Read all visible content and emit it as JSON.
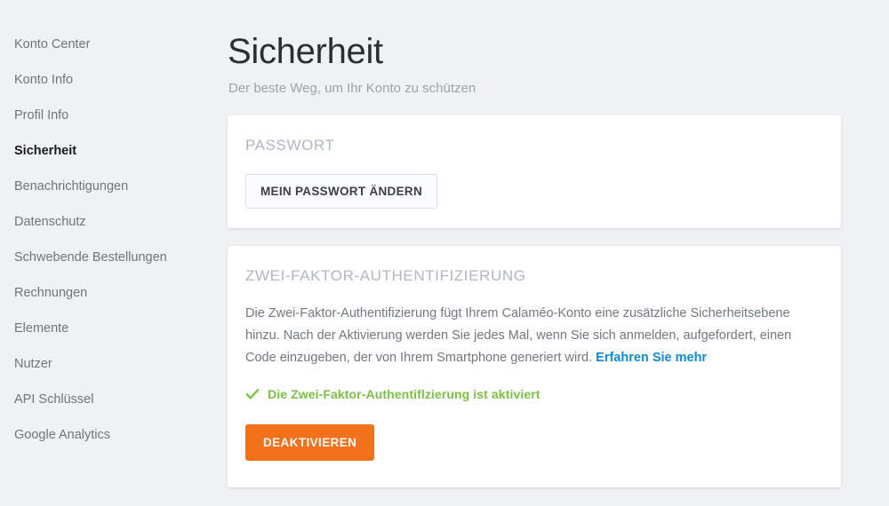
{
  "sidebar": {
    "items": [
      {
        "label": "Konto Center",
        "active": false
      },
      {
        "label": "Konto Info",
        "active": false
      },
      {
        "label": "Profil Info",
        "active": false
      },
      {
        "label": "Sicherheit",
        "active": true
      },
      {
        "label": "Benachrichtigungen",
        "active": false
      },
      {
        "label": "Datenschutz",
        "active": false
      },
      {
        "label": "Schwebende Bestellungen",
        "active": false
      },
      {
        "label": "Rechnungen",
        "active": false
      },
      {
        "label": "Elemente",
        "active": false
      },
      {
        "label": "Nutzer",
        "active": false
      },
      {
        "label": "API Schlüssel",
        "active": false
      },
      {
        "label": "Google Analytics",
        "active": false
      }
    ]
  },
  "header": {
    "title": "Sicherheit",
    "subtitle": "Der beste Weg, um Ihr Konto zu schützen"
  },
  "password_card": {
    "heading": "PASSWORT",
    "change_button_label": "MEIN PASSWORT ÄNDERN"
  },
  "twofa_card": {
    "heading": "ZWEI-FAKTOR-AUTHENTIFIZIERUNG",
    "description_part1": "Die Zwei-Faktor-Authentifizierung fügt Ihrem Calaméo-Konto eine zusätzliche Sicherheitsebene hinzu. Nach der Aktivierung werden Sie jedes Mal, wenn Sie sich anmelden, aufgefordert, einen Code einzugeben, der von Ihrem Smartphone generiert wird.",
    "learn_more_label": "Erfahren Sie mehr",
    "status_icon": "check-icon",
    "status_text": "Die Zwei-Faktor-Authentiflzierung ist aktiviert",
    "deactivate_button_label": "DEAKTIVIEREN"
  },
  "colors": {
    "page_background": "#f0f1f2",
    "card_background": "#ffffff",
    "accent_orange": "#f4711c",
    "link_blue": "#0f8bd7",
    "success_green": "#7ac143",
    "muted_heading": "#aeb7c2",
    "body_text": "#70787f"
  }
}
